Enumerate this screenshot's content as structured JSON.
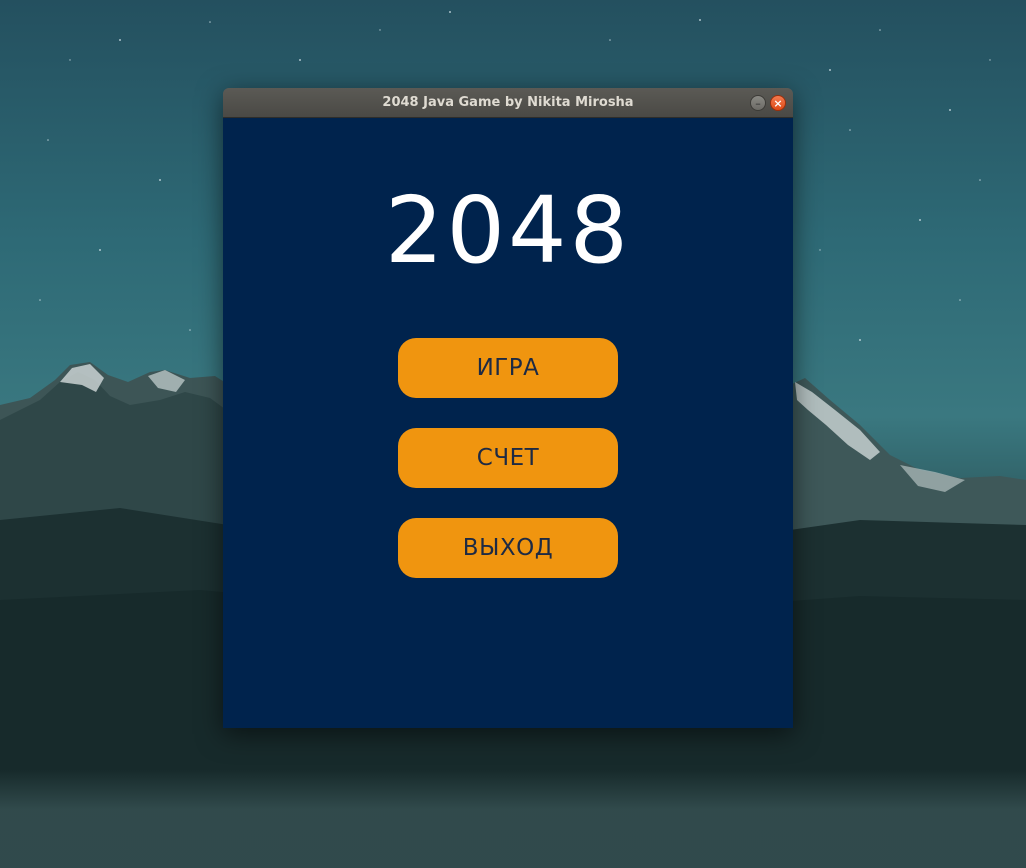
{
  "window": {
    "title": "2048 Java Game by Nikita Mirosha",
    "minimize_glyph": "–",
    "close_glyph": "×"
  },
  "game": {
    "title": "2048",
    "menu": [
      {
        "label": "ИГРА"
      },
      {
        "label": "СЧЕТ"
      },
      {
        "label": "ВЫХОД"
      }
    ]
  },
  "colors": {
    "content_background": "#00234d",
    "button_background": "#f0950f",
    "button_text": "#1d2a44",
    "title_text": "#ffffff"
  },
  "icons": [
    "minimize-icon",
    "close-icon"
  ]
}
